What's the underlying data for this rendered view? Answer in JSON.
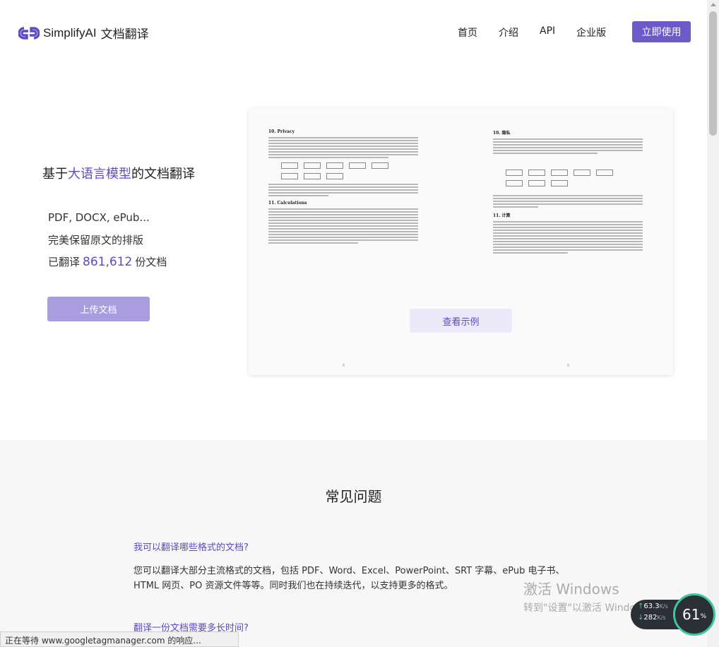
{
  "nav": {
    "brand": "SimplifyAI",
    "product": "文档翻译",
    "links": [
      "首页",
      "介绍",
      "API",
      "企业版"
    ],
    "cta": "立即使用"
  },
  "hero": {
    "title_prefix": "基于",
    "title_highlight": "大语言模型",
    "title_suffix": "的文档翻译",
    "feature_formats": "PDF, DOCX, ePub...",
    "feature_layout": "完美保留原文的排版",
    "count_prefix": "已翻译",
    "count_value": "861,612",
    "count_suffix": "份文档",
    "upload_button": "上传文档",
    "example_button": "查看示例"
  },
  "preview": {
    "left_heading": "10.  Privacy",
    "left_heading2": "11.  Calculations",
    "right_heading": "10. 隐私",
    "right_heading2": "11. 计算",
    "left_page_num": "6",
    "right_page_num": "6"
  },
  "faq": {
    "title": "常见问题",
    "q1": "我可以翻译哪些格式的文档?",
    "a1": "您可以翻译大部分主流格式的文档，包括 PDF、Word、Excel、PowerPoint、SRT 字幕、ePub 电子书、HTML 网页、PO 资源文件等等。同时我们也在持续迭代，以支持更多的格式。",
    "q2": "翻译一份文档需要多长时间?"
  },
  "status_bar": "正在等待 www.googletagmanager.com 的响应...",
  "watermark": {
    "line1": "激活 Windows",
    "line2": "转到\"设置\"以激活 Windows。"
  },
  "network": {
    "up": "63.3",
    "down": "282",
    "unit": "K/s",
    "gauge": "61",
    "gauge_unit": "%"
  }
}
